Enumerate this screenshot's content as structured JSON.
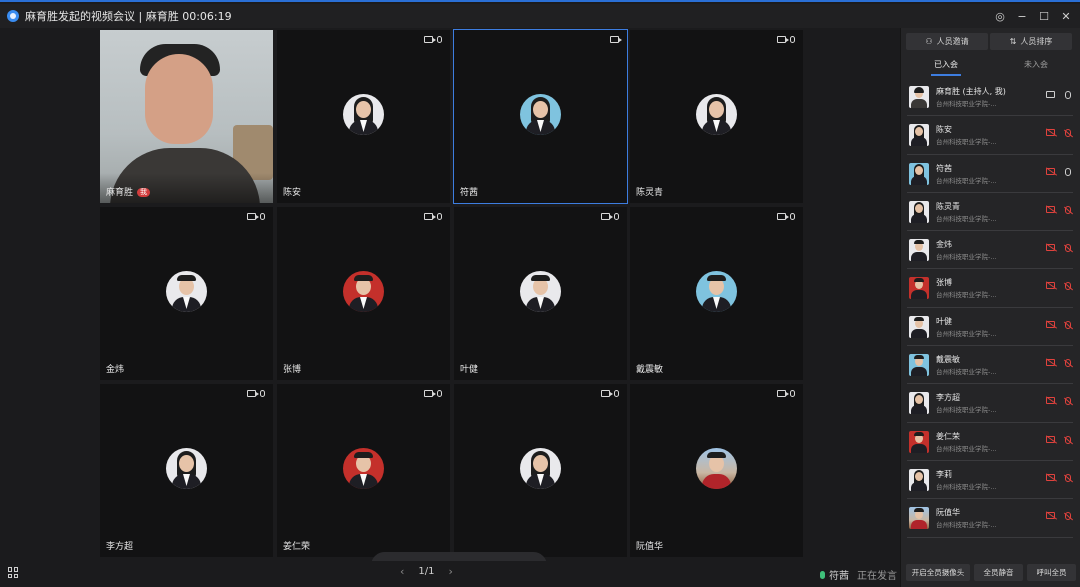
{
  "window": {
    "title": "麻育胜发起的视频会议 | 麻育胜 00:06:19",
    "controls": [
      "target-icon",
      "minimize-icon",
      "maximize-icon",
      "close-icon"
    ]
  },
  "tiles": [
    {
      "name": "麻育胜",
      "badge": "我",
      "camera_on": true,
      "active": false
    },
    {
      "name": "陈安",
      "avatar_style": "female",
      "active": false
    },
    {
      "name": "符茜",
      "avatar_style": "female-blue",
      "active": true
    },
    {
      "name": "陈灵青",
      "avatar_style": "female",
      "active": false
    },
    {
      "name": "金炜",
      "avatar_style": "male",
      "active": false
    },
    {
      "name": "张博",
      "avatar_style": "male-red",
      "active": false
    },
    {
      "name": "叶健",
      "avatar_style": "male",
      "active": false
    },
    {
      "name": "戴震敏",
      "avatar_style": "male-blue",
      "active": false
    },
    {
      "name": "李方超",
      "avatar_style": "female",
      "active": false
    },
    {
      "name": "姜仁荣",
      "avatar_style": "male-red",
      "active": false
    },
    {
      "name": "",
      "avatar_style": "female",
      "active": false
    },
    {
      "name": "阮值华",
      "avatar_style": "tour",
      "active": false
    }
  ],
  "toolbar": {
    "buttons": [
      "microphone-icon",
      "camera-icon",
      "share-screen-icon",
      "more-icon",
      "hang-up-icon"
    ],
    "hangup_color": "#e0423d"
  },
  "bottom": {
    "page_indicator": "1/1",
    "speaker_name": "符茜",
    "speaker_status": "正在发言"
  },
  "sidebar": {
    "invite_label": "人员邀请",
    "sort_label": "人员排序",
    "tab_joined": "已入会",
    "tab_not_joined": "未入会",
    "members": [
      {
        "name": "麻育胜 (主持人, 我)",
        "org": "台州科技职业学院-...",
        "cam_off": false,
        "mic_off": false
      },
      {
        "name": "陈安",
        "org": "台州科技职业学院-...",
        "cam_off": true,
        "mic_off": true
      },
      {
        "name": "符茜",
        "org": "台州科技职业学院-...",
        "cam_off": true,
        "mic_off": false
      },
      {
        "name": "陈灵青",
        "org": "台州科技职业学院-...",
        "cam_off": true,
        "mic_off": true
      },
      {
        "name": "金炜",
        "org": "台州科技职业学院-...",
        "cam_off": true,
        "mic_off": true
      },
      {
        "name": "张博",
        "org": "台州科技职业学院-...",
        "cam_off": true,
        "mic_off": true
      },
      {
        "name": "叶健",
        "org": "台州科技职业学院-...",
        "cam_off": true,
        "mic_off": true
      },
      {
        "name": "戴震敏",
        "org": "台州科技职业学院-...",
        "cam_off": true,
        "mic_off": true
      },
      {
        "name": "李方超",
        "org": "台州科技职业学院-...",
        "cam_off": true,
        "mic_off": true
      },
      {
        "name": "姜仁荣",
        "org": "台州科技职业学院-...",
        "cam_off": true,
        "mic_off": true
      },
      {
        "name": "李莉",
        "org": "台州科技职业学院-...",
        "cam_off": true,
        "mic_off": true
      },
      {
        "name": "阮值华",
        "org": "台州科技职业学院-...",
        "cam_off": true,
        "mic_off": true
      }
    ],
    "footer": {
      "cameras_label": "开启全员摄像头",
      "mute_label": "全员静音",
      "call_label": "呼叫全员"
    }
  },
  "colors": {
    "accent": "#3d7de0",
    "muted_red": "#e0423d",
    "speaking_green": "#3fc07a"
  }
}
